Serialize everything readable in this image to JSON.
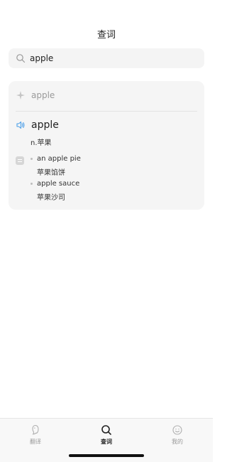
{
  "header": {
    "title": "查词"
  },
  "search": {
    "value": "apple"
  },
  "suggestion": {
    "text": "apple"
  },
  "entry": {
    "word": "apple",
    "definition": "n.苹果",
    "phrases": [
      {
        "en": "an apple pie",
        "cn": "苹果馅饼"
      },
      {
        "en": "apple sauce",
        "cn": "苹果沙司"
      }
    ]
  },
  "tabs": [
    {
      "label": "翻译",
      "icon": "translate-icon",
      "active": false
    },
    {
      "label": "查词",
      "icon": "search-icon",
      "active": true
    },
    {
      "label": "我的",
      "icon": "smiley-icon",
      "active": false
    }
  ],
  "colors": {
    "accent": "#4a9ee8",
    "card_bg": "#f5f5f5"
  }
}
